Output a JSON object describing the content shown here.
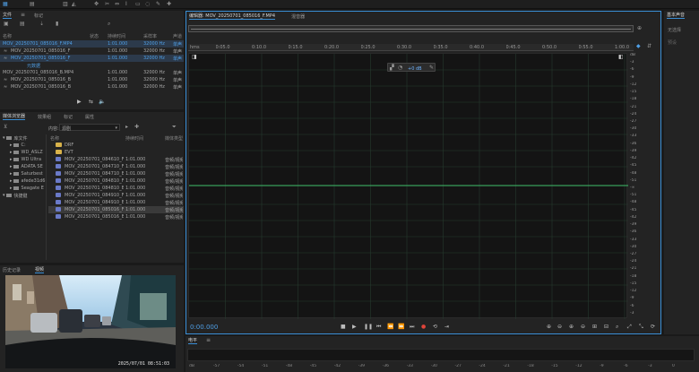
{
  "files_panel": {
    "tabs": [
      "文件",
      "标记"
    ],
    "columns": {
      "name": "名称",
      "status": "状态",
      "duration": "持续时间",
      "sample_rate": "采样率",
      "channel": "声道"
    },
    "rows": [
      {
        "name": "MOV_20250701_085016_F.MP4",
        "status": "",
        "duration": "1:01.000",
        "rate": "32000 Hz",
        "ch": "单声",
        "style": "sel"
      },
      {
        "name": "MOV_20250701_085016_F",
        "status": "",
        "duration": "1:01.000",
        "rate": "32000 Hz",
        "ch": "单声",
        "style": "sub"
      },
      {
        "name": "MOV_20250701_085016_F",
        "status": "",
        "duration": "1:01.000",
        "rate": "32000 Hz",
        "ch": "单声",
        "style": "subsel"
      },
      {
        "name": "元数据",
        "status": "",
        "duration": "",
        "rate": "",
        "ch": "",
        "style": "meta"
      },
      {
        "name": "MOV_20250701_085016_B.MP4",
        "status": "",
        "duration": "1:01.000",
        "rate": "32000 Hz",
        "ch": "单声",
        "style": "normal"
      },
      {
        "name": "MOV_20250701_085016_B",
        "status": "",
        "duration": "1:01.000",
        "rate": "32000 Hz",
        "ch": "单声",
        "style": "sub"
      },
      {
        "name": "MOV_20250701_085016_B",
        "status": "",
        "duration": "1:01.000",
        "rate": "32000 Hz",
        "ch": "单声",
        "style": "sub"
      }
    ]
  },
  "browser_panel": {
    "tabs": [
      "媒体浏览器",
      "效果组",
      "标记",
      "属性"
    ],
    "content_label": "内容:",
    "content_value": "源剧",
    "tree_header": "",
    "tree": [
      {
        "label": "库文件",
        "level": 1,
        "kind": "root"
      },
      {
        "label": "C:",
        "level": 2,
        "kind": "drive"
      },
      {
        "label": "WD_ASLZ",
        "level": 2,
        "kind": "drive"
      },
      {
        "label": "WD Ultra",
        "level": 2,
        "kind": "drive"
      },
      {
        "label": "ADATA SE",
        "level": 2,
        "kind": "drive"
      },
      {
        "label": "Saturbest",
        "level": 2,
        "kind": "drive"
      },
      {
        "label": "afede31d6",
        "level": 2,
        "kind": "drive"
      },
      {
        "label": "Seagate E",
        "level": 2,
        "kind": "drive"
      },
      {
        "label": "快捷键",
        "level": 1,
        "kind": "root"
      }
    ],
    "list_columns": {
      "name": "名称",
      "duration": "持续时间",
      "type": "媒体类型"
    },
    "list": [
      {
        "name": "DRF",
        "duration": "",
        "type": "",
        "kind": "folder"
      },
      {
        "name": "EVT",
        "duration": "",
        "type": "",
        "kind": "folder"
      },
      {
        "name": "MOV_20250701_084610_F.MP4",
        "duration": "1:01.000",
        "type": "音频/视频",
        "kind": "file"
      },
      {
        "name": "MOV_20250701_084710_F.MP4",
        "duration": "1:01.000",
        "type": "音频/视频",
        "kind": "file"
      },
      {
        "name": "MOV_20250701_084710_B.MP4",
        "duration": "1:01.000",
        "type": "音频/视频",
        "kind": "file"
      },
      {
        "name": "MOV_20250701_084810_F.MP4",
        "duration": "1:01.000",
        "type": "音频/视频",
        "kind": "file"
      },
      {
        "name": "MOV_20250701_084810_B.MP4",
        "duration": "1:01.000",
        "type": "音频/视频",
        "kind": "file"
      },
      {
        "name": "MOV_20250701_084910_F.MP4",
        "duration": "1:01.000",
        "type": "音频/视频",
        "kind": "file"
      },
      {
        "name": "MOV_20250701_084910_B.MP4",
        "duration": "1:01.000",
        "type": "音频/视频",
        "kind": "file"
      },
      {
        "name": "MOV_20250701_085016_F.MP4",
        "duration": "1:01.000",
        "type": "音频/视频",
        "kind": "file",
        "hl": true
      },
      {
        "name": "MOV_20250701_085016_B.MP4",
        "duration": "1:01.000",
        "type": "音频/视频",
        "kind": "file"
      }
    ]
  },
  "video_panel": {
    "tabs": [
      "历史记录",
      "视频"
    ],
    "timestamp": "2025/07/01 08:51:03"
  },
  "editor": {
    "tab_label": "编辑器: MOV_20250701_085016_F.MP4",
    "tab2_label": "混音器",
    "time_ticks": [
      "hms",
      "0:05.0",
      "0:10.0",
      "0:15.0",
      "0:20.0",
      "0:25.0",
      "0:30.0",
      "0:35.0",
      "0:40.0",
      "0:45.0",
      "0:50.0",
      "0:55.0",
      "1:00.0"
    ],
    "db_ticks": [
      "dB",
      "-3",
      "-6",
      "-9",
      "-12",
      "-15",
      "-18",
      "-21",
      "-24",
      "-27",
      "-30",
      "-33",
      "-36",
      "-39",
      "-42",
      "-45",
      "-48",
      "-51",
      "-∞",
      "-51",
      "-48",
      "-45",
      "-42",
      "-39",
      "-36",
      "-33",
      "-30",
      "-27",
      "-24",
      "-21",
      "-18",
      "-15",
      "-12",
      "-9",
      "-6",
      "-3"
    ],
    "gain_value": "+0 dB",
    "current_time": "0:00.000"
  },
  "level_panel": {
    "tab": "电平",
    "ticks": [
      "dB",
      "-57",
      "-54",
      "-51",
      "-48",
      "-45",
      "-42",
      "-39",
      "-36",
      "-33",
      "-30",
      "-27",
      "-24",
      "-21",
      "-18",
      "-15",
      "-12",
      "-9",
      "-6",
      "-3",
      "0"
    ]
  },
  "right_panel": {
    "tab": "基本声音",
    "hint": "无选择",
    "preset_label": "预设"
  },
  "colors": {
    "accent": "#3a8fd6",
    "waveform_line": "#3fbf6a",
    "record": "#e0443a",
    "time_text": "#4f9fe6"
  }
}
